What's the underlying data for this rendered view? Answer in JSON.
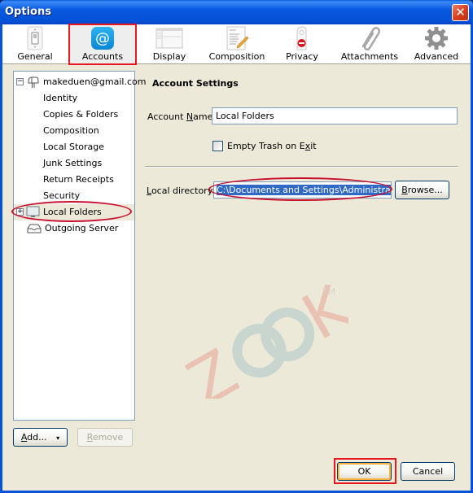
{
  "window": {
    "title": "Options",
    "close_glyph": "✕"
  },
  "toolbar": {
    "items": [
      {
        "label": "General",
        "icon": "light-switch-icon",
        "selected": false
      },
      {
        "label": "Accounts",
        "icon": "at-sign-icon",
        "selected": true
      },
      {
        "label": "Display",
        "icon": "display-window-icon",
        "selected": false
      },
      {
        "label": "Composition",
        "icon": "document-pencil-icon",
        "selected": false
      },
      {
        "label": "Privacy",
        "icon": "do-not-disturb-tag-icon",
        "selected": false
      },
      {
        "label": "Attachments",
        "icon": "paperclip-icon",
        "selected": false
      },
      {
        "label": "Advanced",
        "icon": "gear-icon",
        "selected": false
      }
    ]
  },
  "tree": {
    "account": {
      "label": "makeduen@gmail.com",
      "expander": "−",
      "icon": "mailbox-icon"
    },
    "children": [
      {
        "label": "Identity"
      },
      {
        "label": "Copies & Folders"
      },
      {
        "label": "Composition"
      },
      {
        "label": "Local Storage"
      },
      {
        "label": "Junk Settings"
      },
      {
        "label": "Return Receipts"
      },
      {
        "label": "Security"
      }
    ],
    "local_folders": {
      "label": "Local Folders",
      "expander": "+",
      "icon": "monitor-icon",
      "selected": true
    },
    "outgoing_server": {
      "label": "Outgoing Server",
      "icon": "outbox-tray-icon"
    }
  },
  "buttons": {
    "add": {
      "label_prefix": "",
      "accel": "A",
      "label_rest": "dd...",
      "arrow": "▾"
    },
    "remove": {
      "accel": "R",
      "label_rest": "emove",
      "disabled": true
    },
    "ok": {
      "label": "OK"
    },
    "cancel": {
      "label": "Cancel"
    },
    "browse": {
      "accel": "B",
      "label_rest": "rowse..."
    }
  },
  "settings": {
    "section_title": "Account Settings",
    "account_name": {
      "label_pre": "Account ",
      "accel": "N",
      "label_post": "ame:",
      "value": "Local Folders"
    },
    "empty_trash": {
      "label_pre": "Empty Trash on E",
      "accel": "x",
      "label_post": "it",
      "checked": false
    },
    "local_directory": {
      "accel": "L",
      "label_post": "ocal directory:",
      "value": "C:\\Documents and Settings\\Administrator\\A"
    }
  },
  "watermark": {
    "text": "ZOOK",
    "tm": "TM"
  },
  "colors": {
    "highlight_red": "#e8161d",
    "annotation_ring": "#c8102e",
    "selection_blue": "#316ac5",
    "accounts_icon_blue": "#1aa0e4"
  }
}
